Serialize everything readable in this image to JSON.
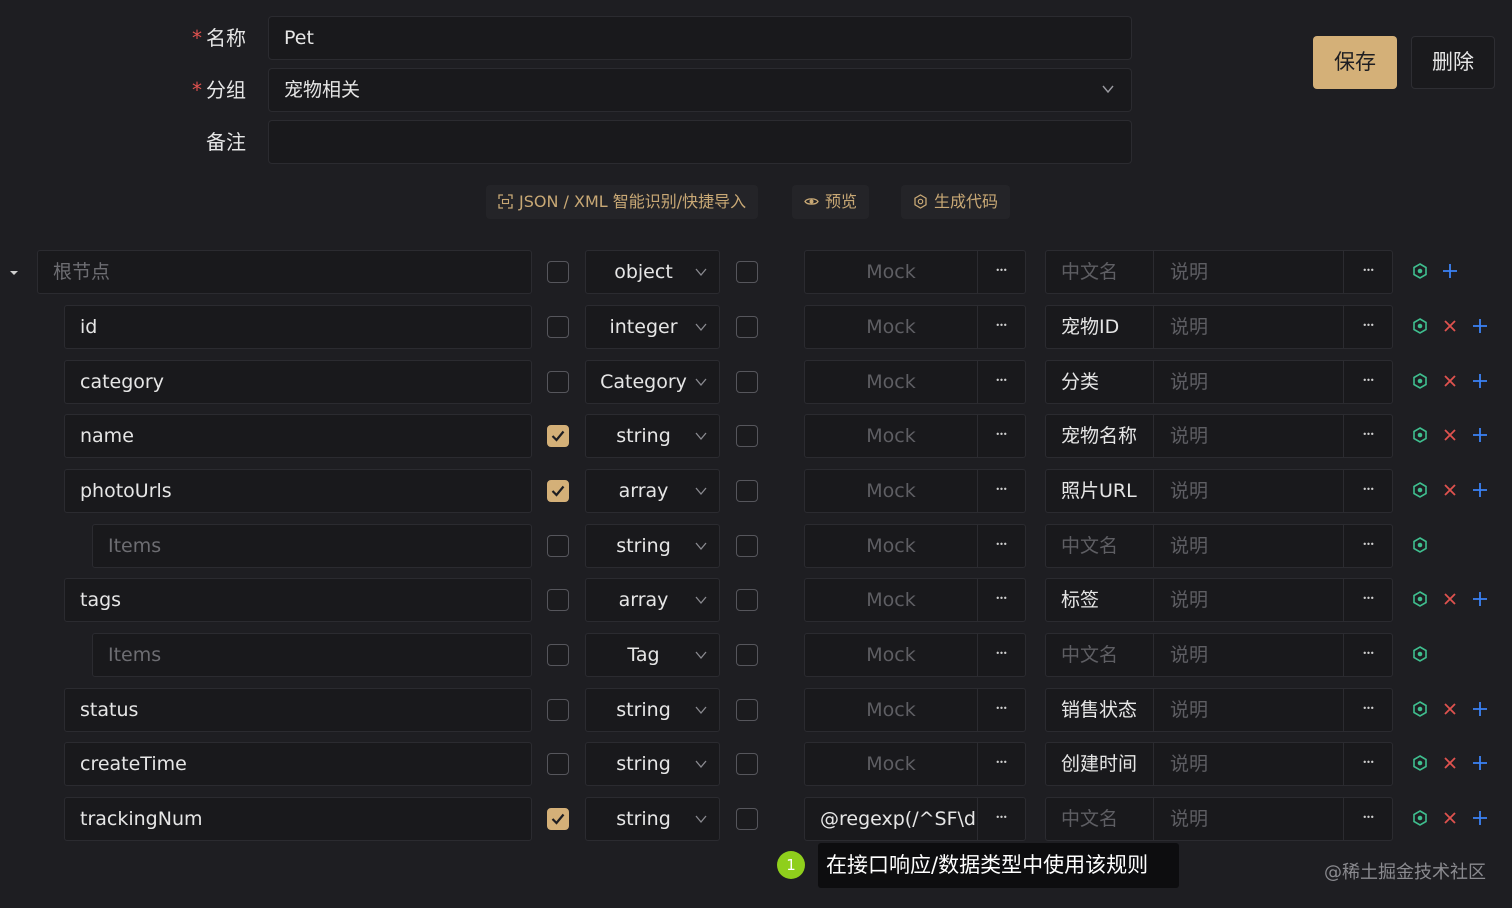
{
  "form": {
    "name_label": "名称",
    "name_value": "Pet",
    "group_label": "分组",
    "group_value": "宠物相关",
    "note_label": "备注",
    "note_value": "",
    "required_mark": "*"
  },
  "actions": {
    "save": "保存",
    "delete": "删除"
  },
  "toolbar": {
    "import": "JSON / XML 智能识别/快捷导入",
    "preview": "预览",
    "codegen": "生成代码"
  },
  "placeholders": {
    "mock": "Mock",
    "cn_name": "中文名",
    "note": "说明",
    "items": "Items",
    "root": "根节点"
  },
  "rows": [
    {
      "name": "根节点",
      "required": false,
      "type": "object",
      "mock": "Mock",
      "cn_name": "中文名",
      "note": "说明"
    },
    {
      "name": "id",
      "required": false,
      "type": "integer",
      "mock": "Mock",
      "cn_name": "宠物ID",
      "note": "说明"
    },
    {
      "name": "category",
      "required": false,
      "type": "Category",
      "mock": "Mock",
      "cn_name": "分类",
      "note": "说明"
    },
    {
      "name": "name",
      "required": true,
      "type": "string",
      "mock": "Mock",
      "cn_name": "宠物名称",
      "note": "说明"
    },
    {
      "name": "photoUrls",
      "required": true,
      "type": "array",
      "mock": "Mock",
      "cn_name": "照片URL",
      "note": "说明"
    },
    {
      "name": "Items",
      "required": false,
      "type": "string",
      "mock": "Mock",
      "cn_name": "中文名",
      "note": "说明"
    },
    {
      "name": "tags",
      "required": false,
      "type": "array",
      "mock": "Mock",
      "cn_name": "标签",
      "note": "说明"
    },
    {
      "name": "Items",
      "required": false,
      "type": "Tag",
      "mock": "Mock",
      "cn_name": "中文名",
      "note": "说明"
    },
    {
      "name": "status",
      "required": false,
      "type": "string",
      "mock": "Mock",
      "cn_name": "销售状态",
      "note": "说明"
    },
    {
      "name": "createTime",
      "required": false,
      "type": "string",
      "mock": "Mock",
      "cn_name": "创建时间",
      "note": "说明"
    },
    {
      "name": "trackingNum",
      "required": true,
      "type": "string",
      "mock": "@regexp(/^SF\\d",
      "cn_name": "中文名",
      "note": "说明"
    }
  ],
  "tooltip": {
    "step": "1",
    "text": "在接口响应/数据类型中使用该规则"
  },
  "watermark": "@稀土掘金技术社区",
  "colors": {
    "accent": "#d4b078",
    "delete": "#e0524f",
    "add": "#3b82f6",
    "eye": "#3fbf8f",
    "step": "#8fcf1c"
  }
}
